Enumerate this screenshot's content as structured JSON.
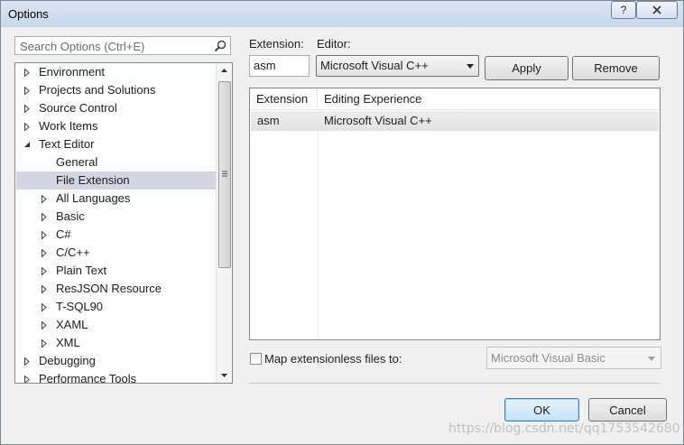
{
  "window": {
    "title": "Options",
    "help_label": "?"
  },
  "search": {
    "placeholder": "Search Options (Ctrl+E)"
  },
  "tree": {
    "items": [
      {
        "label": "Environment",
        "level": 0,
        "expandable": true,
        "expanded": false
      },
      {
        "label": "Projects and Solutions",
        "level": 0,
        "expandable": true,
        "expanded": false
      },
      {
        "label": "Source Control",
        "level": 0,
        "expandable": true,
        "expanded": false
      },
      {
        "label": "Work Items",
        "level": 0,
        "expandable": true,
        "expanded": false
      },
      {
        "label": "Text Editor",
        "level": 0,
        "expandable": true,
        "expanded": true
      },
      {
        "label": "General",
        "level": 1,
        "expandable": false,
        "expanded": false
      },
      {
        "label": "File Extension",
        "level": 1,
        "expandable": false,
        "expanded": false,
        "selected": true
      },
      {
        "label": "All Languages",
        "level": 1,
        "expandable": true,
        "expanded": false
      },
      {
        "label": "Basic",
        "level": 1,
        "expandable": true,
        "expanded": false
      },
      {
        "label": "C#",
        "level": 1,
        "expandable": true,
        "expanded": false
      },
      {
        "label": "C/C++",
        "level": 1,
        "expandable": true,
        "expanded": false
      },
      {
        "label": "Plain Text",
        "level": 1,
        "expandable": true,
        "expanded": false
      },
      {
        "label": "ResJSON Resource",
        "level": 1,
        "expandable": true,
        "expanded": false
      },
      {
        "label": "T-SQL90",
        "level": 1,
        "expandable": true,
        "expanded": false
      },
      {
        "label": "XAML",
        "level": 1,
        "expandable": true,
        "expanded": false
      },
      {
        "label": "XML",
        "level": 1,
        "expandable": true,
        "expanded": false
      },
      {
        "label": "Debugging",
        "level": 0,
        "expandable": true,
        "expanded": false
      },
      {
        "label": "Performance Tools",
        "level": 0,
        "expandable": true,
        "expanded": false
      }
    ]
  },
  "extension_field": {
    "label": "Extension:",
    "value": "asm"
  },
  "editor_field": {
    "label": "Editor:",
    "value": "Microsoft Visual C++"
  },
  "buttons": {
    "apply": "Apply",
    "remove": "Remove",
    "ok": "OK",
    "cancel": "Cancel"
  },
  "table": {
    "columns": [
      "Extension",
      "Editing Experience"
    ],
    "rows": [
      {
        "extension": "asm",
        "editing_experience": "Microsoft Visual C++"
      }
    ]
  },
  "map_extensionless": {
    "label": "Map extensionless files to:",
    "checked": false,
    "value": "Microsoft Visual Basic"
  },
  "watermark": "https://blog.csdn.net/qq1753542680",
  "colors": {
    "selection": "#d2d6e2",
    "default_button_border": "#3c7fb1"
  }
}
